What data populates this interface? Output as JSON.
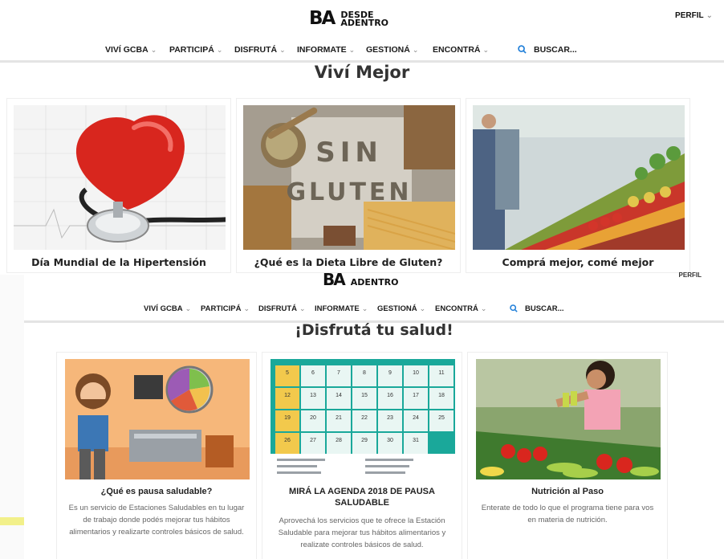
{
  "top": {
    "logo": {
      "mark": "BA",
      "line1": "DESDE",
      "line2": "ADENTRO"
    },
    "profile": "PERFIL",
    "nav": [
      "VIVÍ GCBA",
      "PARTICIPÁ",
      "DISFRUTÁ",
      "INFORMATE",
      "GESTIONÁ",
      "ENCONTRÁ"
    ],
    "search": "BUSCAR...",
    "section_title": "Viví Mejor",
    "cards": [
      {
        "caption": "Día Mundial de la Hipertensión"
      },
      {
        "caption": "¿Qué es la Dieta Libre de Gluten?",
        "img_text1": "SIN",
        "img_text2": "GLUTEN"
      },
      {
        "caption": "Comprá mejor, comé mejor"
      }
    ]
  },
  "bottom": {
    "logo": {
      "mark": "BA",
      "line2": "ADENTRO"
    },
    "profile": "PERFIL",
    "nav": [
      "VIVÍ GCBA",
      "PARTICIPÁ",
      "DISFRUTÁ",
      "INFORMATE",
      "GESTIONÁ",
      "ENCONTRÁ"
    ],
    "search": "BUSCAR...",
    "section_title": "¡Disfrutá tu salud!",
    "cards": [
      {
        "title": "¿Qué es pausa saludable?",
        "desc": "Es un servicio de Estaciones Saludables en tu lugar de trabajo donde podés mejorar tus hábitos alimentarios y realizarte controles básicos de salud."
      },
      {
        "title": "MIRÁ LA AGENDA 2018 DE PAUSA SALUDABLE",
        "desc": "Aprovechá los servicios que te ofrece la Estación Saludable para mejorar tus hábitos alimentarios y realizate controles básicos de salud.",
        "calendar": [
          "5",
          "6",
          "7",
          "8",
          "9",
          "10",
          "11",
          "12",
          "13",
          "14",
          "15",
          "16",
          "17",
          "18",
          "19",
          "20",
          "21",
          "22",
          "23",
          "24",
          "25",
          "26",
          "27",
          "28",
          "29",
          "30",
          "31"
        ]
      },
      {
        "title": "Nutrición al Paso",
        "desc": "Enterate de todo lo que el programa tiene para vos en materia de nutrición."
      }
    ]
  },
  "colors": {
    "search_icon": "#1f7ed8",
    "accent_heart": "#d8261e",
    "calendar_green": "#1aa89a"
  },
  "icons": [
    "chevron-down-icon",
    "search-icon"
  ]
}
